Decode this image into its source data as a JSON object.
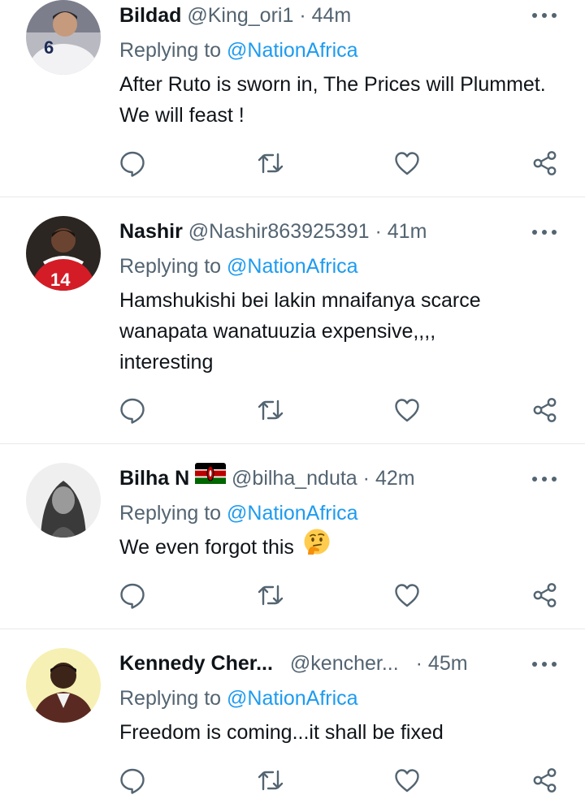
{
  "tweets": [
    {
      "name": "Bildad",
      "handle": "@King_ori1",
      "separator": "·",
      "time": "44m",
      "replying_prefix": "Replying to",
      "replying_to": "@NationAfrica",
      "text": "After Ruto is sworn in, The Prices will Plummet. We will feast !"
    },
    {
      "name": "Nashir",
      "handle": "@Nashir863925391",
      "separator": "·",
      "time": "41m",
      "replying_prefix": "Replying to",
      "replying_to": "@NationAfrica",
      "text": "Hamshukishi bei lakin mnaifanya scarce wanapata wanatuuzia expensive,,,, interesting"
    },
    {
      "name": "Bilha N",
      "name_flag_icon": "kenya-flag-icon",
      "handle": "@bilha_nduta",
      "separator": "·",
      "time": "42m",
      "replying_prefix": "Replying to",
      "replying_to": "@NationAfrica",
      "text": "We even forgot this",
      "text_emoji_icon": "thinking-face-icon"
    },
    {
      "name": "Kennedy Cher...",
      "handle": "@kencher...",
      "separator": "·",
      "time": "45m",
      "replying_prefix": "Replying to",
      "replying_to": "@NationAfrica",
      "text": "Freedom is coming...it shall be fixed"
    }
  ],
  "actions": [
    "reply-icon",
    "retweet-icon",
    "like-icon",
    "share-icon"
  ],
  "colors": {
    "text": "#0f1419",
    "secondary": "#536471",
    "link": "#1d9bf0",
    "divider": "#e6e9ec"
  }
}
